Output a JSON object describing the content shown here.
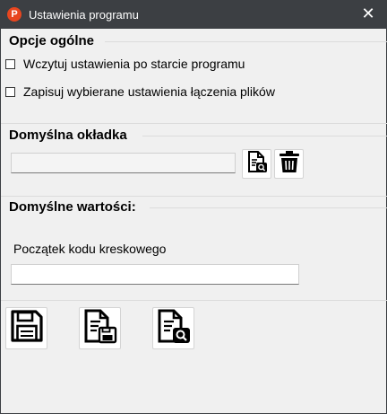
{
  "window": {
    "title": "Ustawienia programu",
    "app_icon_letter": "P",
    "close_glyph": "✕",
    "accent": "#e8461f",
    "titlebar_color": "#3c3f43"
  },
  "general": {
    "title": "Opcje ogólne",
    "checkbox_load": {
      "label": "Wczytuj ustawienia po starcie programu",
      "checked": false
    },
    "checkbox_save": {
      "label": "Zapisuj wybierane ustawienia łączenia plików",
      "checked": false
    }
  },
  "cover": {
    "title": "Domyślna okładka",
    "path_value": "",
    "browse_icon": "document-search-icon",
    "delete_icon": "trash-icon"
  },
  "defaults": {
    "title": "Domyślne wartości:",
    "barcode_label": "Początek kodu kreskowego",
    "barcode_value": ""
  },
  "toolbar": {
    "save_icon": "floppy-disk-icon",
    "save_to_file_icon": "document-save-icon",
    "load_from_file_icon": "document-search-icon"
  }
}
